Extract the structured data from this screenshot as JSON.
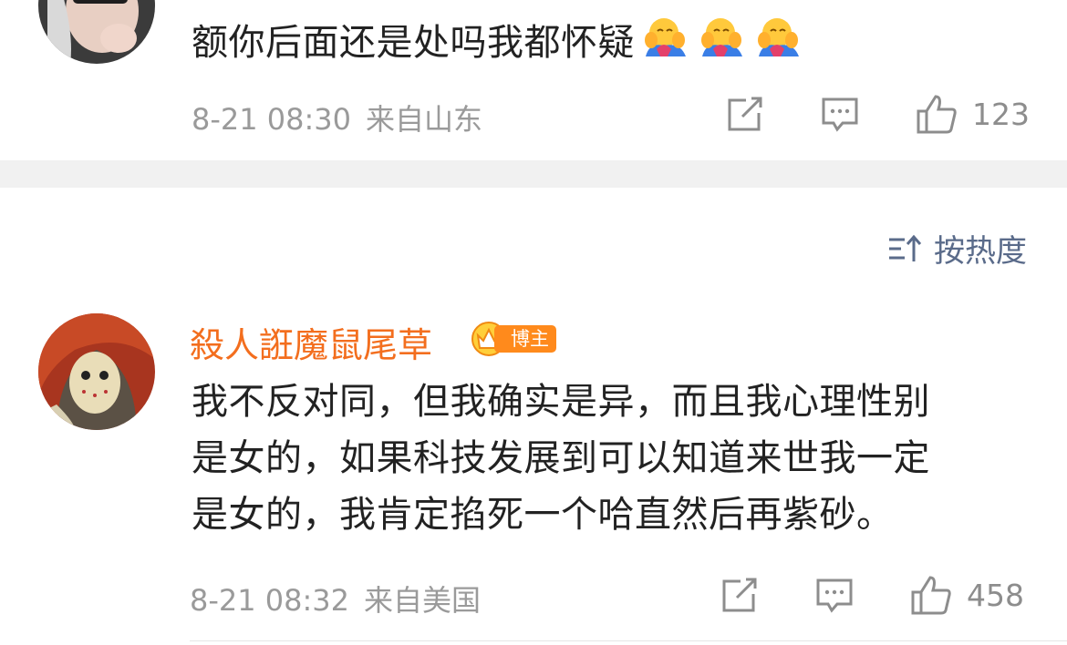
{
  "comment1": {
    "text": "额你后面还是处吗我都怀疑",
    "emoji_icon": "hug-face-emoji",
    "emoji_count": 3,
    "time": "8-21 08:30",
    "location": "来自山东",
    "likes": "123"
  },
  "sort": {
    "label": "按热度"
  },
  "comment2": {
    "username": "殺人誑魔鼠尾草",
    "badge": "博主",
    "text_lines": [
      "我不反对同，但我确实是异，而且我心理性别",
      "是女的，如果科技发展到可以知道来世我一定",
      "是女的，我肯定掐死一个哈直然后再紫砂。"
    ],
    "time": "8-21 08:32",
    "location": "来自美国",
    "likes": "458"
  },
  "colors": {
    "username": "#f36e1e",
    "badge": "#ff8a1c",
    "meta": "#9a9a9a",
    "sort": "#5a6b8a"
  }
}
